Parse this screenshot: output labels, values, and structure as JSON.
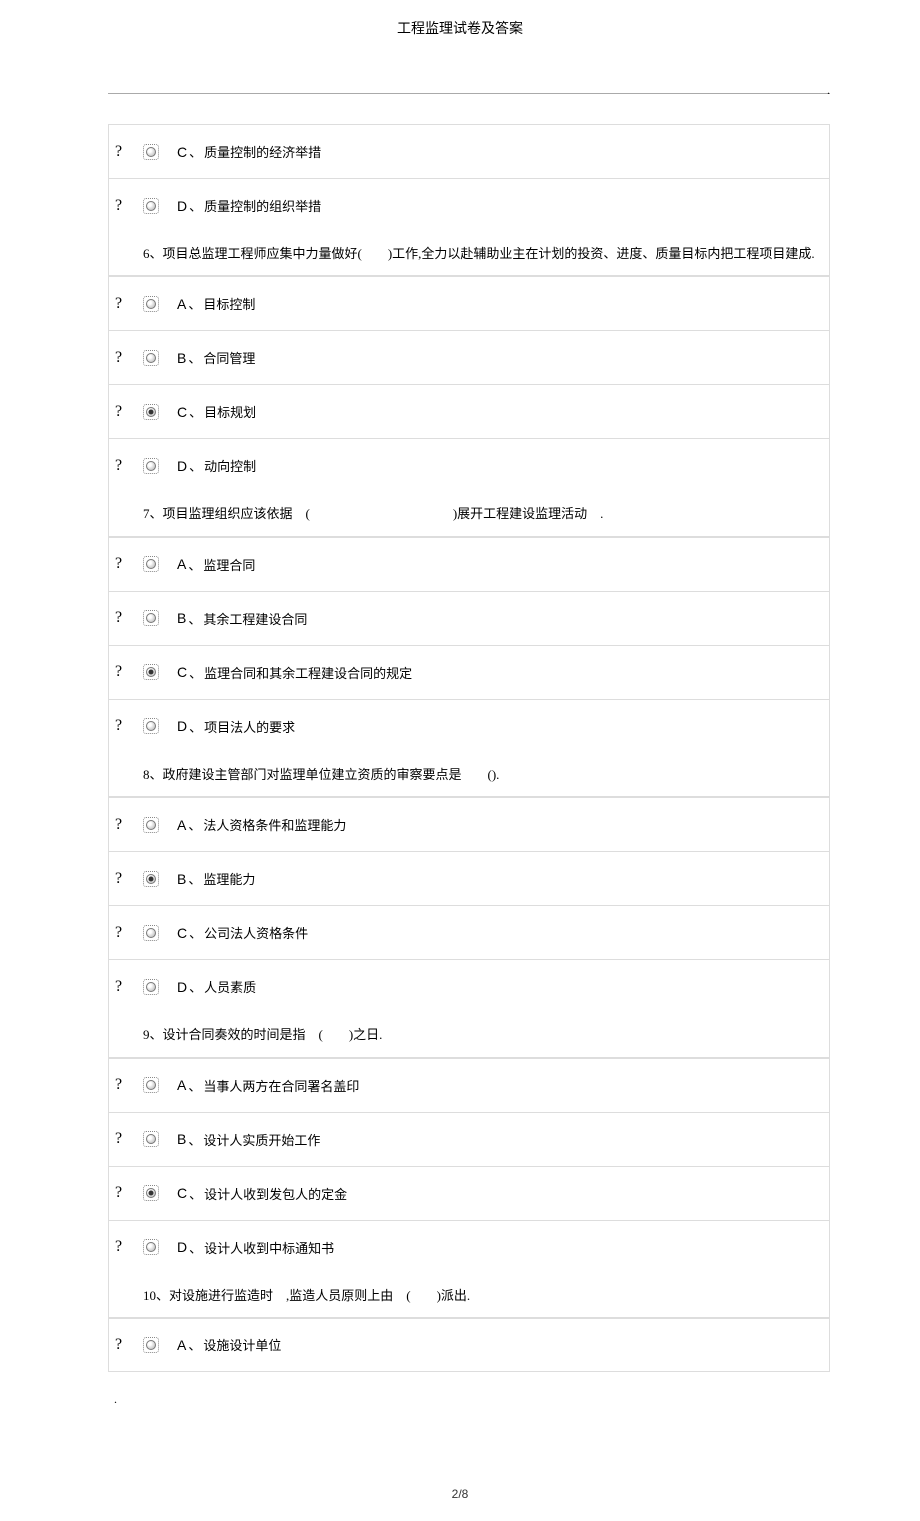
{
  "header": {
    "title": "工程监理试卷及答案"
  },
  "top_marker": ".",
  "bottom_marker": ".",
  "qmark": "?",
  "sep": "、",
  "orphan_options": [
    {
      "letter": "C",
      "text": "质量控制的经济举措",
      "selected": false
    },
    {
      "letter": "D",
      "text": "质量控制的组织举措",
      "selected": false
    }
  ],
  "questions": [
    {
      "num": "6",
      "text": "、项目总监理工程师应集中力量做好(　　)工作,全力以赴辅助业主在计划的投资、进度、质量目标内把工程项目建成.",
      "options": [
        {
          "letter": "A",
          "text": "目标控制",
          "selected": false
        },
        {
          "letter": "B",
          "text": "合同管理",
          "selected": false
        },
        {
          "letter": "C",
          "text": "目标规划",
          "selected": true
        },
        {
          "letter": "D",
          "text": "动向控制",
          "selected": false
        }
      ]
    },
    {
      "num": "7",
      "text": "、项目监理组织应该依据　(　　　　　　　　　　　)展开工程建设监理活动　.",
      "options": [
        {
          "letter": "A",
          "text": "监理合同",
          "selected": false
        },
        {
          "letter": "B",
          "text": "其余工程建设合同",
          "selected": false
        },
        {
          "letter": "C",
          "text": "监理合同和其余工程建设合同的规定",
          "selected": true
        },
        {
          "letter": "D",
          "text": "项目法人的要求",
          "selected": false
        }
      ]
    },
    {
      "num": "8",
      "text": "、政府建设主管部门对监理单位建立资质的审察要点是　　().",
      "options": [
        {
          "letter": "A",
          "text": "法人资格条件和监理能力",
          "selected": false
        },
        {
          "letter": "B",
          "text": "监理能力",
          "selected": true
        },
        {
          "letter": "C",
          "text": "公司法人资格条件",
          "selected": false
        },
        {
          "letter": "D",
          "text": "人员素质",
          "selected": false
        }
      ]
    },
    {
      "num": "9",
      "text": "、设计合同奏效的时间是指　(　　)之日.",
      "options": [
        {
          "letter": "A",
          "text": "当事人两方在合同署名盖印",
          "selected": false
        },
        {
          "letter": "B",
          "text": "设计人实质开始工作",
          "selected": false
        },
        {
          "letter": "C",
          "text": "设计人收到发包人的定金",
          "selected": true
        },
        {
          "letter": "D",
          "text": "设计人收到中标通知书",
          "selected": false
        }
      ]
    },
    {
      "num": "10",
      "text": "、对设施进行监造时　,监造人员原则上由　(　　)派出.",
      "options": [
        {
          "letter": "A",
          "text": "设施设计单位",
          "selected": false
        }
      ]
    }
  ],
  "footer": {
    "page": "2",
    "total": "8"
  }
}
